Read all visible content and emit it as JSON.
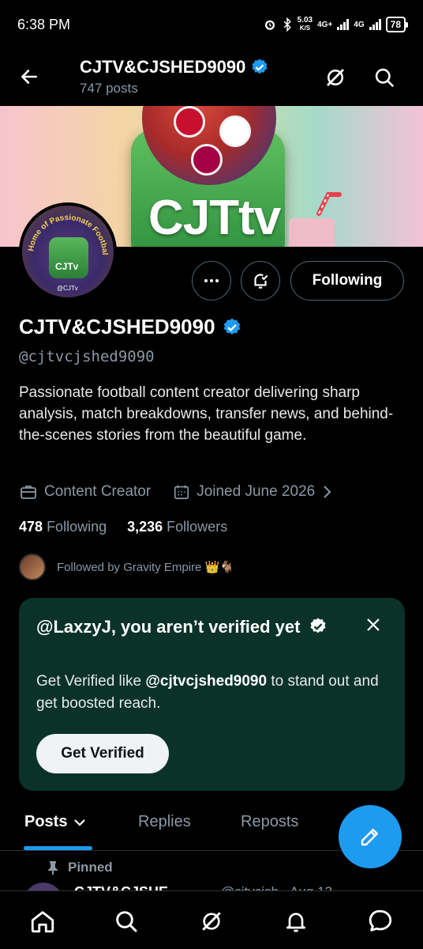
{
  "status_bar": {
    "time": "6:38 PM",
    "net_speed_value": "5.03",
    "net_speed_unit": "K/S",
    "network_1": "4G+",
    "network_2": "4G",
    "battery": "78"
  },
  "header": {
    "title": "CJTV&CJSHED9090",
    "subtitle": "747 posts"
  },
  "banner": {
    "brand_text": "CJTtv"
  },
  "avatar": {
    "ring_text": "Home of Passionate Football Fans",
    "brand_text": "CJTv",
    "tag_text": "@CJTv"
  },
  "actions": {
    "following_label": "Following"
  },
  "profile": {
    "name": "CJTV&CJSHED9090",
    "handle": "@cjtvcjshed9090",
    "bio": "Passionate football content creator delivering sharp analysis, match breakdowns, transfer news, and behind-the-scenes stories from the beautiful game.",
    "category": "Content Creator",
    "joined": "Joined June 2026",
    "following_count": "478",
    "following_label": "Following",
    "followers_count": "3,236",
    "followers_label": "Followers",
    "followed_by": "Followed by Gravity Empire 👑🐐"
  },
  "verify_card": {
    "title": "@LaxzyJ, you aren’t verified yet",
    "desc_prefix": "Get Verified like ",
    "desc_handle": "@cjtvcjshed9090",
    "desc_suffix": " to stand out and get boosted reach.",
    "button_label": "Get Verified"
  },
  "tabs": [
    {
      "label": "Posts",
      "active": true
    },
    {
      "label": "Replies",
      "active": false
    },
    {
      "label": "Reposts",
      "active": false
    }
  ],
  "pinned": {
    "label": "Pinned",
    "author_name": "CJTV&CJSHE",
    "meta": "@cjtvcjsh · Aug 13"
  },
  "colors": {
    "accent": "#1d9bf0",
    "verify_card_bg": "#0a3228",
    "muted_text": "#8b98a5"
  },
  "icons": {
    "back": "arrow-left-icon",
    "grok": "grok-icon",
    "search": "search-icon",
    "more": "more-horizontal-icon",
    "notify": "bell-subscribe-icon",
    "verified": "verified-badge-icon",
    "briefcase": "briefcase-icon",
    "calendar": "calendar-icon",
    "close": "close-icon",
    "compose": "compose-icon",
    "home": "home-icon",
    "notifications": "bell-icon",
    "messages": "messages-icon"
  }
}
